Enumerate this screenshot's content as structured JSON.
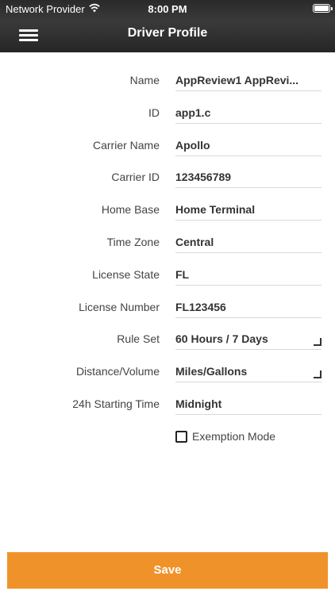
{
  "status_bar": {
    "carrier": "Network Provider",
    "wifi_icon": "wifi-icon",
    "time": "8:00 PM",
    "battery_icon": "battery-icon"
  },
  "header": {
    "menu_icon": "hamburger-menu-icon",
    "title": "Driver Profile",
    "background": "#2b2b2b"
  },
  "fields": {
    "name": {
      "label": "Name",
      "value": "AppReview1 AppRevi..."
    },
    "id": {
      "label": "ID",
      "value": "app1.c"
    },
    "carrier_name": {
      "label": "Carrier Name",
      "value": "Apollo"
    },
    "carrier_id": {
      "label": "Carrier ID",
      "value": "123456789"
    },
    "home_base": {
      "label": "Home Base",
      "value": "Home Terminal"
    },
    "time_zone": {
      "label": "Time Zone",
      "value": "Central"
    },
    "license_state": {
      "label": "License State",
      "value": "FL"
    },
    "license_number": {
      "label": "License Number",
      "value": "FL123456"
    },
    "rule_set": {
      "label": "Rule Set",
      "value": "60 Hours / 7 Days",
      "icon": "dropdown-corner-icon"
    },
    "distance_volume": {
      "label": "Distance/Volume",
      "value": "Miles/Gallons",
      "icon": "dropdown-corner-icon"
    },
    "starting_time": {
      "label": "24h Starting Time",
      "value": "Midnight"
    }
  },
  "exemption": {
    "label": "Exemption Mode",
    "checked": false
  },
  "save": {
    "label": "Save",
    "color": "#f0922a"
  }
}
